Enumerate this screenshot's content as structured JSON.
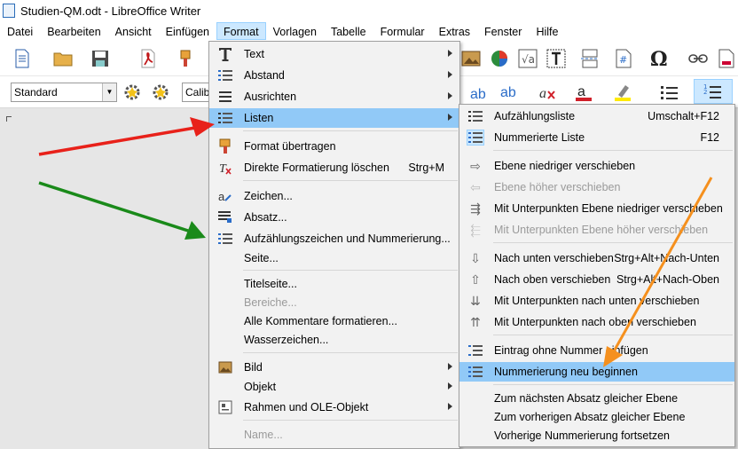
{
  "window": {
    "title": "Studien-QM.odt - LibreOffice Writer"
  },
  "menubar": [
    "Datei",
    "Bearbeiten",
    "Ansicht",
    "Einfügen",
    "Format",
    "Vorlagen",
    "Tabelle",
    "Formular",
    "Extras",
    "Fenster",
    "Hilfe"
  ],
  "toolbar": {
    "style_value": "Standard",
    "font_value": "Calib"
  },
  "format_menu": {
    "items": [
      {
        "label": "Text",
        "submenu": true,
        "icon": "text-T-icon"
      },
      {
        "label": "Abstand",
        "submenu": true,
        "icon": "spacing-icon"
      },
      {
        "label": "Ausrichten",
        "submenu": true,
        "icon": "align-icon"
      },
      {
        "label": "Listen",
        "submenu": true,
        "icon": "list-icon"
      },
      {
        "label": "Format übertragen",
        "icon": "paintbrush-icon"
      },
      {
        "label": "Direkte Formatierung löschen",
        "shortcut": "Strg+M",
        "icon": "clear-format-icon"
      },
      {
        "label": "Zeichen...",
        "icon": "character-icon"
      },
      {
        "label": "Absatz...",
        "icon": "paragraph-icon"
      },
      {
        "label": "Aufzählungszeichen und Nummerierung...",
        "icon": "bullets-numbering-icon"
      },
      {
        "label": "Seite..."
      },
      {
        "label": "Titelseite..."
      },
      {
        "label": "Bereiche...",
        "disabled": true
      },
      {
        "label": "Alle Kommentare formatieren..."
      },
      {
        "label": "Wasserzeichen..."
      },
      {
        "label": "Bild",
        "submenu": true,
        "icon": "image-icon"
      },
      {
        "label": "Objekt",
        "submenu": true
      },
      {
        "label": "Rahmen und OLE-Objekt",
        "submenu": true,
        "icon": "frame-icon"
      },
      {
        "label": "Name...",
        "disabled": true
      }
    ]
  },
  "lists_submenu": {
    "items": [
      {
        "label": "Aufzählungsliste",
        "shortcut": "Umschalt+F12"
      },
      {
        "label": "Nummerierte Liste",
        "shortcut": "F12"
      },
      {
        "label": "Ebene niedriger verschieben"
      },
      {
        "label": "Ebene höher verschieben",
        "disabled": true
      },
      {
        "label": "Mit Unterpunkten Ebene niedriger verschieben"
      },
      {
        "label": "Mit Unterpunkten Ebene höher verschieben",
        "disabled": true
      },
      {
        "label": "Nach unten verschieben",
        "shortcut": "Strg+Alt+Nach-Unten"
      },
      {
        "label": "Nach oben verschieben",
        "shortcut": "Strg+Alt+Nach-Oben"
      },
      {
        "label": "Mit Unterpunkten nach unten verschieben"
      },
      {
        "label": "Mit Unterpunkten nach oben verschieben"
      },
      {
        "label": "Eintrag ohne Nummer einfügen"
      },
      {
        "label": "Nummerierung neu beginnen"
      },
      {
        "label": "Zum nächsten Absatz gleicher Ebene"
      },
      {
        "label": "Zum vorherigen Absatz gleicher Ebene"
      },
      {
        "label": "Vorherige Nummerierung fortsetzen"
      }
    ]
  },
  "annotation_colors": {
    "red": "#e8211a",
    "green": "#1a8a1a",
    "orange": "#f5901e"
  },
  "highlight_color": "#91c9f7"
}
